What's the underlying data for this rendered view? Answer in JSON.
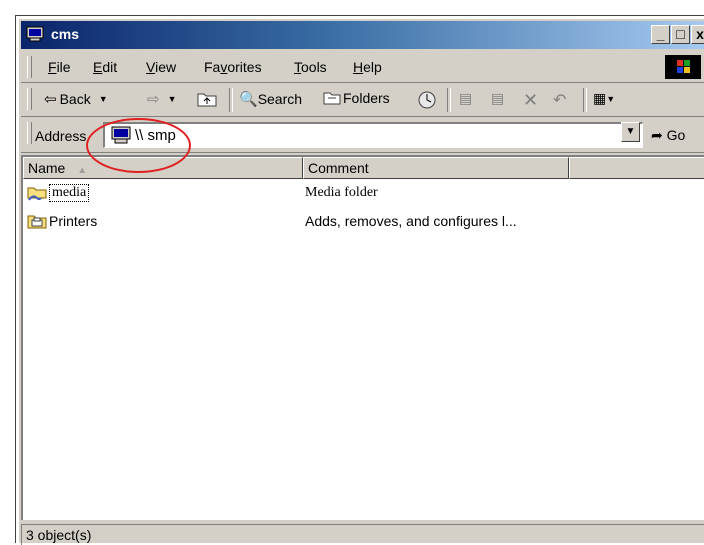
{
  "window": {
    "title": "cms"
  },
  "titlebar_buttons": {
    "minimize": "_",
    "maximize": "□",
    "close": "x"
  },
  "menu": [
    "File",
    "Edit",
    "View",
    "Favorites",
    "Tools",
    "Help"
  ],
  "menu_underline": [
    "F",
    "E",
    "V",
    "v",
    "T",
    "H"
  ],
  "toolbar": {
    "back_label": "Back",
    "search_label": "Search",
    "folders_label": "Folders"
  },
  "address": {
    "label": "Address",
    "value": "\\\\ smp",
    "go_label": "Go"
  },
  "columns": [
    "Name",
    "Comment"
  ],
  "rows": [
    {
      "name": "media",
      "comment": "Media folder",
      "icon": "shared-folder-icon"
    },
    {
      "name": "Printers",
      "comment": "Adds, removes, and configures l...",
      "icon": "printers-folder-icon"
    }
  ],
  "status": {
    "text": "3 object(s)"
  },
  "colors": {
    "title_start": "#0a246a",
    "title_end": "#a6caf0",
    "highlight_circle": "#e02020",
    "face": "#d4d0c8"
  }
}
